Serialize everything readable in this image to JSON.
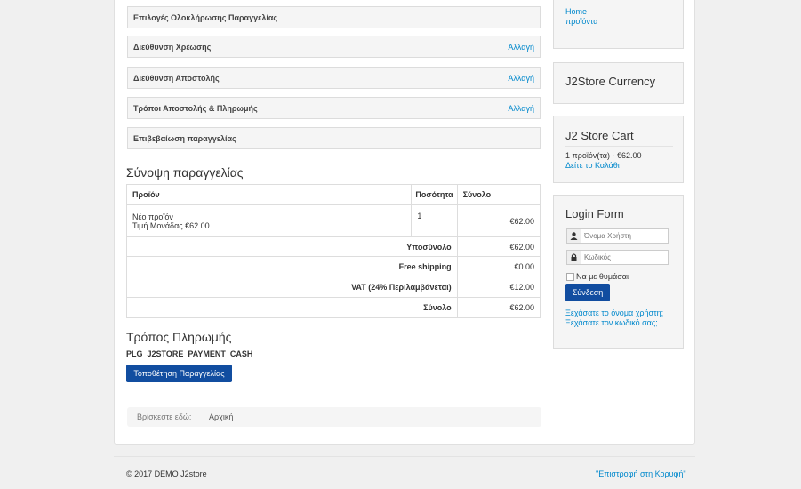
{
  "steps": [
    {
      "title": "Επιλογές Ολοκλήρωσης Παραγγελίας",
      "action": ""
    },
    {
      "title": "Διεύθυνση Χρέωσης",
      "action": "Αλλαγή"
    },
    {
      "title": "Διεύθυνση Αποστολής",
      "action": "Αλλαγή"
    },
    {
      "title": "Τρόποι Αποστολής & Πληρωμής",
      "action": "Αλλαγή"
    },
    {
      "title": "Επιβεβαίωση παραγγελίας",
      "action": ""
    }
  ],
  "summary": {
    "heading": "Σύνοψη παραγγελίας",
    "columns": [
      "Προϊόν",
      "Ποσότητα",
      "Σύνολο"
    ],
    "item": {
      "name": "Νέο προϊόν",
      "unit_price": "Τιμή Μονάδας €62.00",
      "qty": "1",
      "total": "€62.00"
    },
    "totals": [
      {
        "label": "Υποσύνολο",
        "value": "€62.00"
      },
      {
        "label": "Free shipping",
        "value": "€0.00"
      },
      {
        "label": "VAT (24% Περιλαμβάνεται)",
        "value": "€12.00"
      },
      {
        "label": "Σύνολο",
        "value": "€62.00"
      }
    ]
  },
  "payment": {
    "heading": "Τρόπος Πληρωμής",
    "method": "PLG_J2STORE_PAYMENT_CASH",
    "place_order": "Τοποθέτηση Παραγγελίας"
  },
  "breadcrumb": {
    "label": "Βρίσκεστε εδώ:",
    "home": "Αρχική"
  },
  "sidebar": {
    "menu": [
      "Home",
      "προϊόντα"
    ],
    "currency_title": "J2Store Currency",
    "cart_title": "J2 Store Cart",
    "cart_summary": "1 προϊόν(τα) - €62.00",
    "cart_link": "Δείτε το Καλάθι",
    "login_title": "Login Form",
    "username_placeholder": "Όνομα Χρήστη",
    "password_placeholder": "Κωδικός",
    "remember": "Να με θυμάσαι",
    "login_button": "Σύνδεση",
    "forgot_username": "Ξεχάσατε το όνομα χρήστη;",
    "forgot_password": "Ξεχάσατε τον κωδικό σας;"
  },
  "footer": {
    "copyright": "© 2017 DEMO J2store",
    "back_to_top": "\"Επιστροφή στη Κορυφή\""
  },
  "colors": {
    "accent": "#0088cc",
    "button": "#114da0"
  }
}
